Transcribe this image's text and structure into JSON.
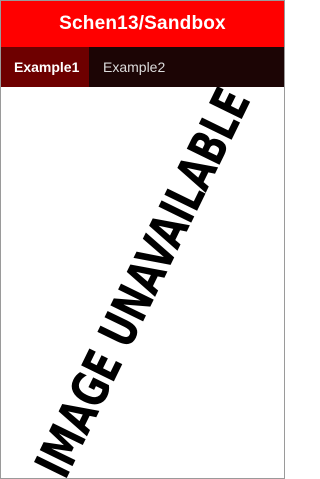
{
  "header": {
    "title": "Schen13/Sandbox",
    "background_color": "#ff0000"
  },
  "tabs": [
    {
      "label": "Example1",
      "active": true
    },
    {
      "label": "Example2",
      "active": false
    }
  ],
  "content": {
    "image_placeholder_text": "IMAGE UNAVAILABLE"
  },
  "colors": {
    "tabbar_background": "#1c0505",
    "active_tab_background": "#6e0000"
  }
}
